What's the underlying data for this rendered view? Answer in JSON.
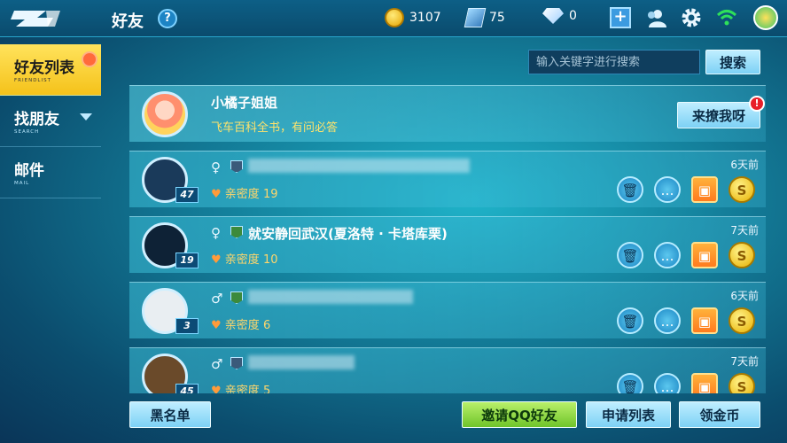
{
  "header": {
    "title": "好友",
    "help": "?",
    "coins": "3107",
    "cards": "75",
    "gems": "0"
  },
  "nav": {
    "items": [
      {
        "label": "好友列表",
        "sub": "FRIENDLIST"
      },
      {
        "label": "找朋友",
        "sub": "SEARCH"
      },
      {
        "label": "邮件",
        "sub": "MAIL"
      }
    ]
  },
  "search": {
    "placeholder": "输入关键字进行搜索",
    "button": "搜索"
  },
  "me": {
    "name": "小橘子姐姐",
    "signature": "飞车百科全书，有问必答",
    "flirt_button": "来撩我呀",
    "flirt_badge": "!"
  },
  "friends": [
    {
      "name": "",
      "level": "47",
      "intimacy_label": "亲密度",
      "intimacy": "19",
      "time": "6天前",
      "gender": "♀"
    },
    {
      "name": "就安静回武汉(夏洛特 · 卡塔库栗)",
      "level": "19",
      "intimacy_label": "亲密度",
      "intimacy": "10",
      "time": "7天前",
      "gender": "♀"
    },
    {
      "name": "",
      "level": "3",
      "intimacy_label": "亲密度",
      "intimacy": "6",
      "time": "6天前",
      "gender": "♂"
    },
    {
      "name": "",
      "level": "45",
      "intimacy_label": "亲密度",
      "intimacy": "5",
      "time": "7天前",
      "gender": "♂"
    }
  ],
  "bottom": {
    "blacklist": "黑名单",
    "invite_qq": "邀请QQ好友",
    "requests": "申请列表",
    "claim_coins": "领金币"
  }
}
